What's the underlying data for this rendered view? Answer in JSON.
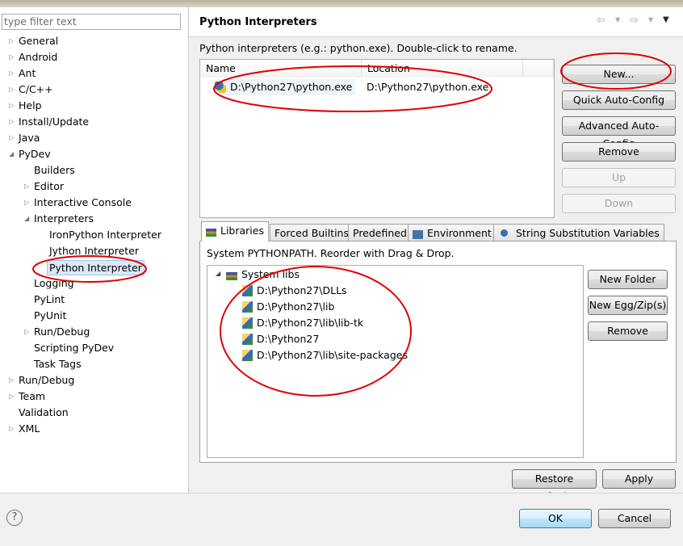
{
  "sidebar": {
    "filter_placeholder": "type filter text",
    "items": [
      {
        "label": "General",
        "level": 0,
        "expander": "collapsed"
      },
      {
        "label": "Android",
        "level": 0,
        "expander": "collapsed"
      },
      {
        "label": "Ant",
        "level": 0,
        "expander": "collapsed"
      },
      {
        "label": "C/C++",
        "level": 0,
        "expander": "collapsed"
      },
      {
        "label": "Help",
        "level": 0,
        "expander": "collapsed"
      },
      {
        "label": "Install/Update",
        "level": 0,
        "expander": "collapsed"
      },
      {
        "label": "Java",
        "level": 0,
        "expander": "collapsed"
      },
      {
        "label": "PyDev",
        "level": 0,
        "expander": "expanded"
      },
      {
        "label": "Builders",
        "level": 1,
        "expander": "none"
      },
      {
        "label": "Editor",
        "level": 1,
        "expander": "collapsed"
      },
      {
        "label": "Interactive Console",
        "level": 1,
        "expander": "collapsed"
      },
      {
        "label": "Interpreters",
        "level": 1,
        "expander": "expanded"
      },
      {
        "label": "IronPython Interpreter",
        "level": 2,
        "expander": "none"
      },
      {
        "label": "Jython Interpreter",
        "level": 2,
        "expander": "none"
      },
      {
        "label": "Python Interpreter",
        "level": 2,
        "expander": "none",
        "selected": true
      },
      {
        "label": "Logging",
        "level": 1,
        "expander": "none"
      },
      {
        "label": "PyLint",
        "level": 1,
        "expander": "none"
      },
      {
        "label": "PyUnit",
        "level": 1,
        "expander": "none"
      },
      {
        "label": "Run/Debug",
        "level": 1,
        "expander": "collapsed"
      },
      {
        "label": "Scripting PyDev",
        "level": 1,
        "expander": "none"
      },
      {
        "label": "Task Tags",
        "level": 1,
        "expander": "none"
      },
      {
        "label": "Run/Debug",
        "level": 0,
        "expander": "collapsed"
      },
      {
        "label": "Team",
        "level": 0,
        "expander": "collapsed"
      },
      {
        "label": "Validation",
        "level": 0,
        "expander": "none"
      },
      {
        "label": "XML",
        "level": 0,
        "expander": "collapsed"
      }
    ]
  },
  "header": {
    "title": "Python Interpreters",
    "nav_icons": [
      "back-arrow-icon",
      "forward-arrow-icon",
      "view-menu-icon"
    ]
  },
  "interpreters": {
    "description": "Python interpreters (e.g.: python.exe).   Double-click to rename.",
    "columns": [
      "Name",
      "Location"
    ],
    "rows": [
      {
        "name": "D:\\Python27\\python.exe",
        "location": "D:\\Python27\\python.exe"
      }
    ],
    "buttons": {
      "new": "New...",
      "quick": "Quick Auto-Config",
      "advanced": "Advanced Auto-Config",
      "remove": "Remove",
      "up": "Up",
      "down": "Down"
    }
  },
  "tabs": [
    "Libraries",
    "Forced Builtins",
    "Predefined",
    "Environment",
    "String Substitution Variables"
  ],
  "libraries": {
    "description": "System PYTHONPATH.   Reorder with Drag & Drop.",
    "root": "System libs",
    "paths": [
      "D:\\Python27\\DLLs",
      "D:\\Python27\\lib",
      "D:\\Python27\\lib\\lib-tk",
      "D:\\Python27",
      "D:\\Python27\\lib\\site-packages"
    ],
    "buttons": {
      "new_folder": "New Folder",
      "new_egg": "New Egg/Zip(s)",
      "remove": "Remove"
    }
  },
  "footer": {
    "restore": "Restore Defaults",
    "apply": "Apply",
    "ok": "OK",
    "cancel": "Cancel",
    "help": "?"
  },
  "colors": {
    "annotation": "#e00000",
    "selection": "#dbe9f7",
    "ok_border": "#3c7fb1"
  }
}
